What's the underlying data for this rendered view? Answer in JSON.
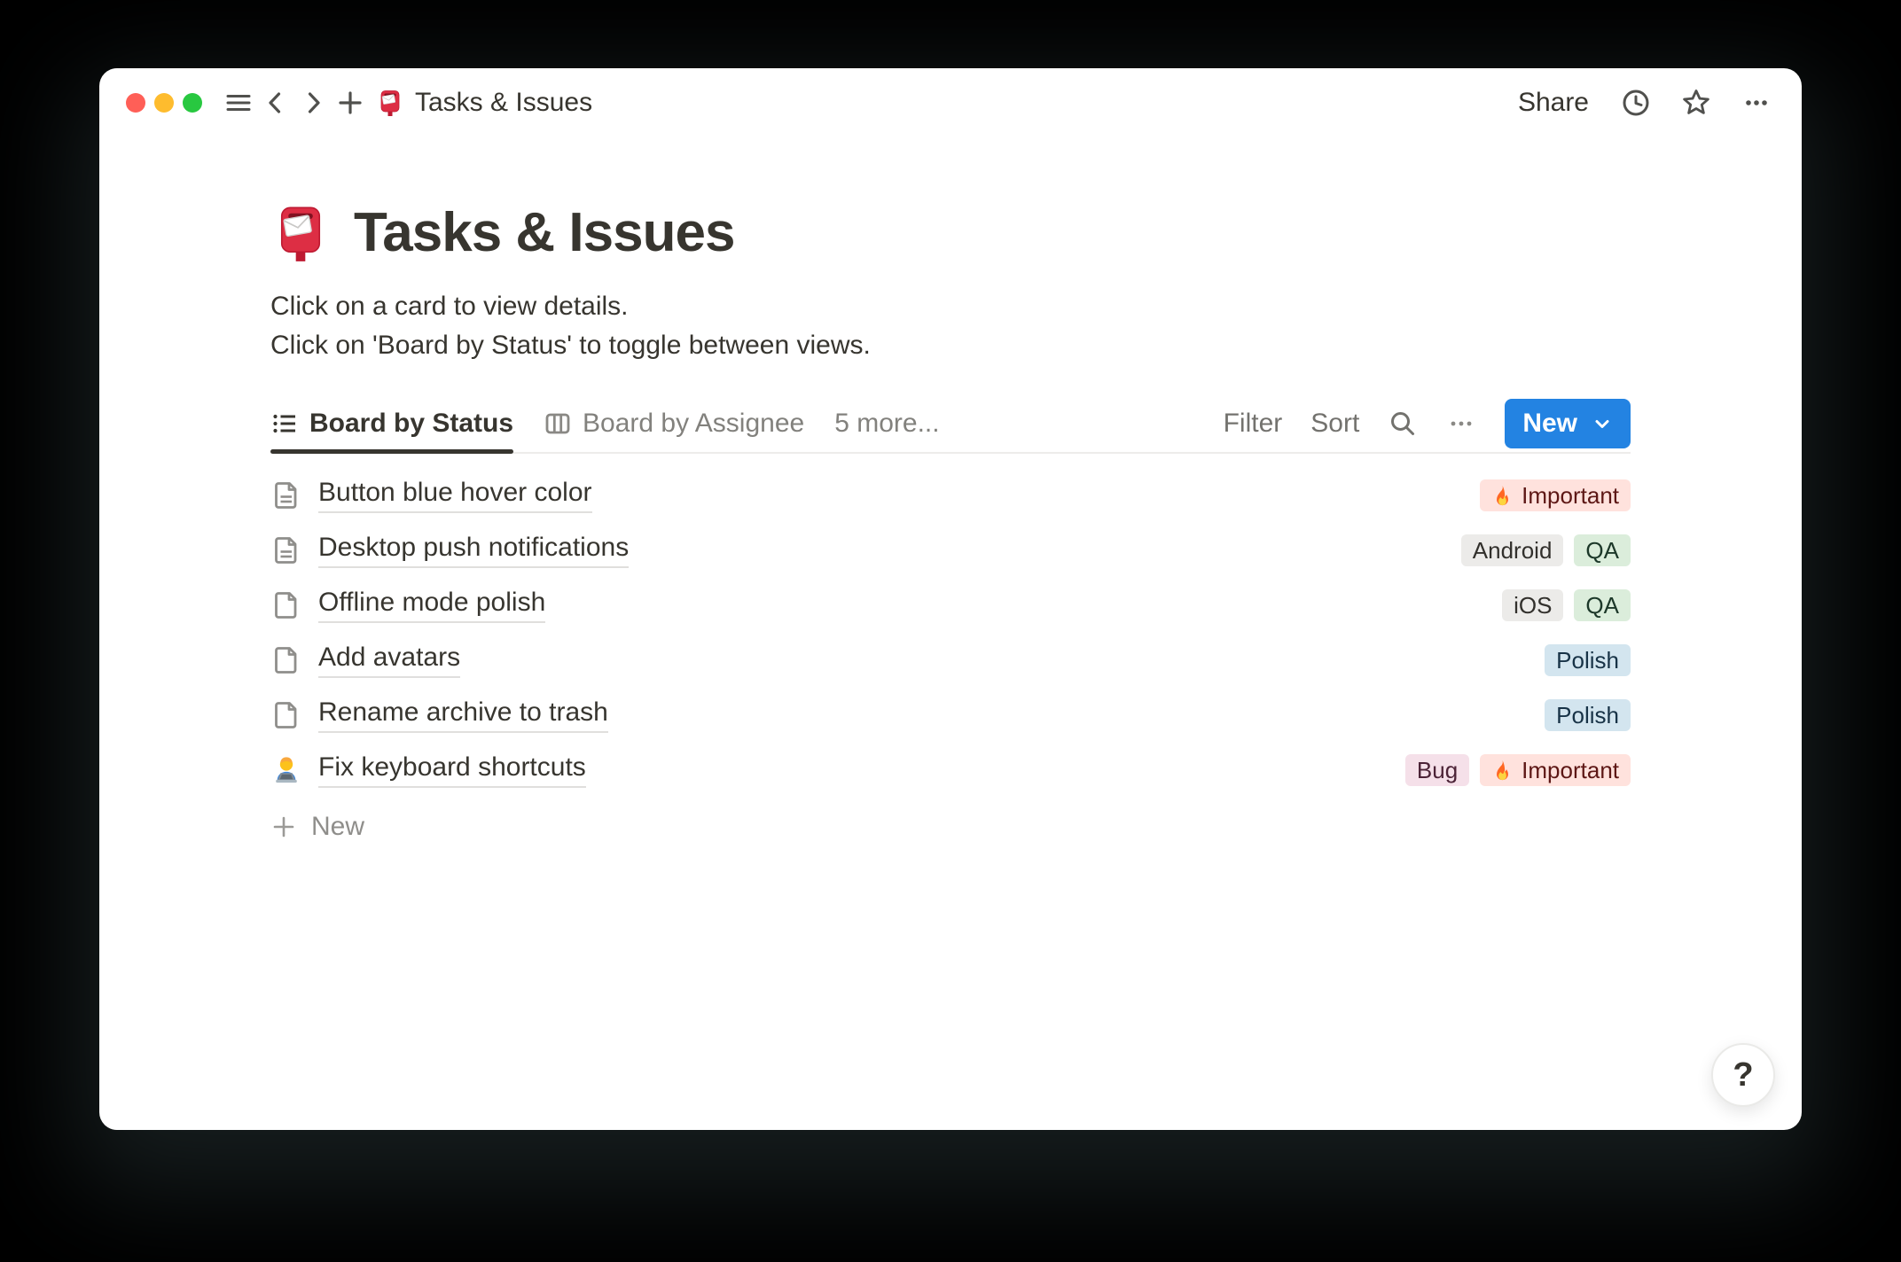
{
  "window": {
    "toolbar": {
      "title": "Tasks & Issues",
      "title_icon": "mailbox-icon",
      "left_icons": [
        "hamburger-menu-icon",
        "back-icon",
        "forward-icon",
        "new-page-icon"
      ],
      "share_label": "Share",
      "right_icons": [
        "history-clock-icon",
        "favorite-star-icon",
        "more-options-icon"
      ]
    },
    "page": {
      "icon": "mailbox-icon",
      "title": "Tasks & Issues",
      "description_line1": "Click on a card to view details.",
      "description_line2": "Click on 'Board by Status' to toggle between views."
    },
    "views": {
      "tabs": [
        {
          "label": "Board by Status",
          "icon": "list-view-icon",
          "active": true
        },
        {
          "label": "Board by Assignee",
          "icon": "board-view-icon",
          "active": false
        },
        {
          "label": "5 more...",
          "icon": null,
          "active": false
        }
      ],
      "controls": {
        "filter_label": "Filter",
        "sort_label": "Sort",
        "icons": [
          "search-icon",
          "more-options-icon"
        ],
        "new_label": "New",
        "new_button_color": "#2383E2"
      }
    },
    "list": {
      "rows": [
        {
          "icon": "page-text-icon",
          "title": "Button blue hover color",
          "tags": [
            {
              "label": "Important",
              "color": "red",
              "fire": true
            }
          ]
        },
        {
          "icon": "page-text-icon",
          "title": "Desktop push notifications",
          "tags": [
            {
              "label": "Android",
              "color": "gray"
            },
            {
              "label": "QA",
              "color": "green"
            }
          ]
        },
        {
          "icon": "page-icon",
          "title": "Offline mode polish",
          "tags": [
            {
              "label": "iOS",
              "color": "gray"
            },
            {
              "label": "QA",
              "color": "green"
            }
          ]
        },
        {
          "icon": "page-icon",
          "title": "Add avatars",
          "tags": [
            {
              "label": "Polish",
              "color": "blue"
            }
          ]
        },
        {
          "icon": "page-icon",
          "title": "Rename archive to trash",
          "tags": [
            {
              "label": "Polish",
              "color": "blue"
            }
          ]
        },
        {
          "icon": "technologist-icon",
          "title": "Fix keyboard shortcuts",
          "tags": [
            {
              "label": "Bug",
              "color": "pink"
            },
            {
              "label": "Important",
              "color": "red",
              "fire": true
            }
          ]
        }
      ],
      "new_row_label": "New"
    },
    "help_label": "?",
    "tag_colors": {
      "red": {
        "bg": "#FFE2DD",
        "text": "#5D1715"
      },
      "gray": {
        "bg": "#ECEBE9",
        "text": "#32302C"
      },
      "green": {
        "bg": "#DBEDDB",
        "text": "#1C3829"
      },
      "blue": {
        "bg": "#D3E5EF",
        "text": "#183347"
      },
      "pink": {
        "bg": "#F5E0E9",
        "text": "#4C2337"
      }
    },
    "traffic_light_colors": [
      "#FF5F57",
      "#FEBC2E",
      "#28C840"
    ]
  }
}
